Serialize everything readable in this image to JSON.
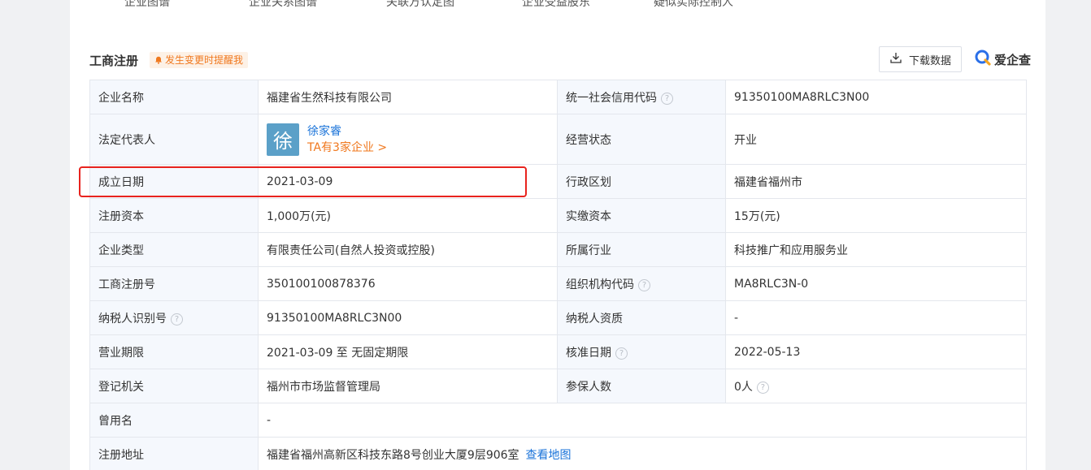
{
  "top_tabs": [
    "企业图谱",
    "企业关系图谱",
    "关联方认定图",
    "企业受益股东",
    "疑似实际控制人"
  ],
  "section": {
    "title": "工商注册",
    "remind_label": "发生变更时提醒我"
  },
  "toolbar": {
    "download_label": "下载数据",
    "brand": "爱企查"
  },
  "rows": [
    {
      "k1": "企业名称",
      "v1": "福建省生然科技有限公司",
      "k2": "统一社会信用代码",
      "v2": "91350100MA8RLC3N00"
    },
    {
      "k1": "法定代表人",
      "k2": "经营状态",
      "v2": "开业"
    },
    {
      "k1": "成立日期",
      "v1": "2021-03-09",
      "k2": "行政区划",
      "v2": "福建省福州市"
    },
    {
      "k1": "注册资本",
      "v1": "1,000万(元)",
      "k2": "实缴资本",
      "v2": "15万(元)"
    },
    {
      "k1": "企业类型",
      "v1": "有限责任公司(自然人投资或控股)",
      "k2": "所属行业",
      "v2": "科技推广和应用服务业"
    },
    {
      "k1": "工商注册号",
      "v1": "350100100878376",
      "k2": "组织机构代码",
      "v2": "MA8RLC3N-0"
    },
    {
      "k1": "纳税人识别号",
      "v1": "91350100MA8RLC3N00",
      "k2": "纳税人资质",
      "v2": "-"
    },
    {
      "k1": "营业期限",
      "v1": "2021-03-09 至 无固定期限",
      "k2": "核准日期",
      "v2": "2022-05-13"
    },
    {
      "k1": "登记机关",
      "v1": "福州市市场监督管理局",
      "k2": "参保人数",
      "v2": "0人"
    },
    {
      "k1": "曾用名",
      "v1": "-"
    },
    {
      "k1": "注册地址",
      "v1": "福建省福州高新区科技东路8号创业大厦9层906室",
      "link": "查看地图"
    }
  ],
  "legal_rep": {
    "avatar_char": "徐",
    "name": "徐家睿",
    "companies": "TA有3家企业 >"
  },
  "help_glyph": "?",
  "colors": {
    "link": "#1a73d9",
    "accent": "#f0781e",
    "highlight": "#e8231e",
    "key_bg": "#f5f8fd"
  }
}
